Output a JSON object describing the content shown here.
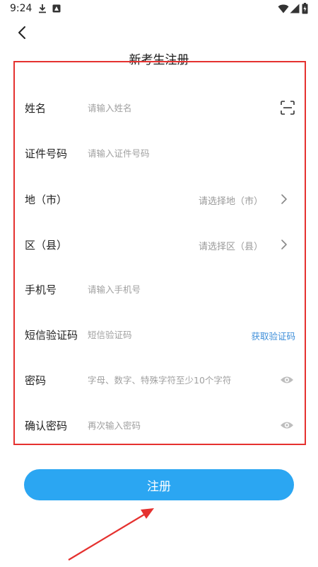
{
  "status_bar": {
    "time": "9:24"
  },
  "header": {
    "back_icon": "chevron-left-icon",
    "title": "新考生注册"
  },
  "form": {
    "rows": [
      {
        "label": "姓名",
        "placeholder": "请输入姓名",
        "value": "",
        "trailing_icon": "scan-icon"
      },
      {
        "label": "证件号码",
        "placeholder": "请输入证件号码",
        "value": ""
      },
      {
        "label": "地（市）",
        "select_placeholder": "请选择地（市）",
        "trailing_icon": "chevron-right-icon"
      },
      {
        "label": "区（县）",
        "select_placeholder": "请选择区（县）",
        "trailing_icon": "chevron-right-icon"
      },
      {
        "label": "手机号",
        "placeholder": "请输入手机号",
        "value": ""
      },
      {
        "label": "短信验证码",
        "placeholder": "短信验证码",
        "value": "",
        "action_label": "获取验证码"
      },
      {
        "label": "密码",
        "placeholder": "字母、数字、特殊字符至少10个字符",
        "value": "",
        "trailing_icon": "eye-icon"
      },
      {
        "label": "确认密码",
        "placeholder": "再次输入密码",
        "value": "",
        "trailing_icon": "eye-icon"
      }
    ]
  },
  "register_button": {
    "label": "注册"
  },
  "colors": {
    "accent": "#2ba6f2",
    "link": "#3d8ed9",
    "annotation": "#e5312f"
  }
}
